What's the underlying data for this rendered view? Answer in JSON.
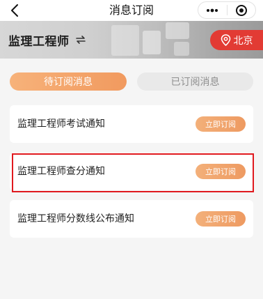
{
  "navbar": {
    "title": "消息订阅",
    "back_icon": "chevron-left-icon",
    "more_icon": "more-dots-icon",
    "close_icon": "target-circle-icon"
  },
  "banner": {
    "exam_name": "监理工程师",
    "swap_icon": "swap-arrows-icon",
    "city": "北京",
    "city_icon": "location-pin-icon",
    "city_button_color": "#e23b34"
  },
  "tabs": [
    {
      "label": "待订阅消息",
      "active": true
    },
    {
      "label": "已订阅消息",
      "active": false
    }
  ],
  "notices": [
    {
      "title": "监理工程师考试通知",
      "button": "立即订阅"
    },
    {
      "title": "监理工程师查分通知",
      "button": "立即订阅"
    },
    {
      "title": "监理工程师分数线公布通知",
      "button": "立即订阅"
    }
  ],
  "colors": {
    "accent_orange": "#f19a5f",
    "highlight_red": "#e0191e",
    "background": "#f5f5f5"
  }
}
